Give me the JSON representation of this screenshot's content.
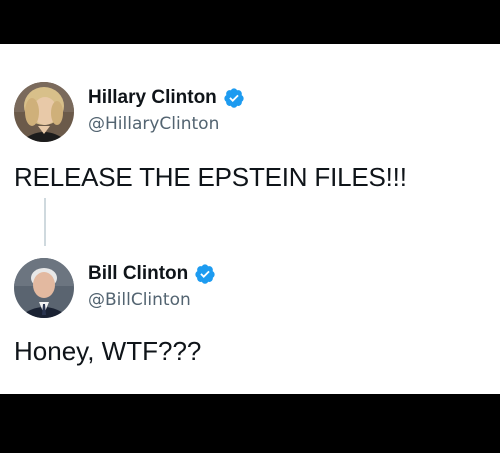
{
  "tweets": [
    {
      "author_name": "Hillary Clinton",
      "handle": "@HillaryClinton",
      "text": "RELEASE THE EPSTEIN FILES!!!",
      "verified": true
    },
    {
      "author_name": "Bill Clinton",
      "handle": "@BillClinton",
      "text": "Honey, WTF???",
      "verified": true
    }
  ],
  "colors": {
    "background": "#ffffff",
    "letterbox": "#000000",
    "text_primary": "#0f1419",
    "text_secondary": "#536471",
    "verified_badge": "#1d9bf0",
    "thread_line": "#cfd9de"
  },
  "icons": {
    "verified": "verified-badge-icon"
  }
}
